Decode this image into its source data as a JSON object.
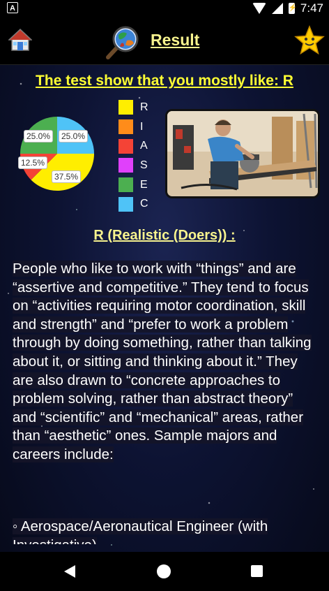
{
  "status_bar": {
    "time": "7:47",
    "left_icon": "A",
    "battery_badge": "⚡"
  },
  "header": {
    "title": "Result",
    "home_icon": "home-icon",
    "globe_icon": "globe-magnifier-icon",
    "star_icon": "star-icon"
  },
  "headline": "The test show that you mostly like: R",
  "chart_data": {
    "type": "pie",
    "slices": [
      {
        "label": "R",
        "value": 37.5,
        "color": "#ffee00"
      },
      {
        "label": "I",
        "value": 0,
        "color": "#ff8c1a"
      },
      {
        "label": "A",
        "value": 12.5,
        "color": "#f44336"
      },
      {
        "label": "S",
        "value": 0,
        "color": "#e040fb"
      },
      {
        "label": "E",
        "value": 25.0,
        "color": "#4caf50"
      },
      {
        "label": "C",
        "value": 25.0,
        "color": "#4fc3f7"
      }
    ],
    "slice_labels": [
      "25.0%",
      "25.0%",
      "12.5%",
      "37.5%"
    ]
  },
  "legend": [
    {
      "letter": "R",
      "color": "#ffee00"
    },
    {
      "letter": "I",
      "color": "#ff8c1a"
    },
    {
      "letter": "A",
      "color": "#f44336"
    },
    {
      "letter": "S",
      "color": "#e040fb"
    },
    {
      "letter": "E",
      "color": "#4caf50"
    },
    {
      "letter": "C",
      "color": "#4fc3f7"
    }
  ],
  "section_title": "R (Realistic (Doers)) :",
  "description": "People who like to work with “things” and are “assertive and competitive.” They tend to focus on “activities requiring motor coordination, skill and strength” and “prefer to work a problem through by doing something, rather than talking about it, or sitting and thinking about it.” They are also drawn to “concrete approaches to problem solving, rather than abstract theory” and “scientific” and “mechanical” areas, rather than “aesthetic” ones. Sample majors and careers include:",
  "list_item": "◦ Aerospace/Aeronautical Engineer (with Investigative)"
}
